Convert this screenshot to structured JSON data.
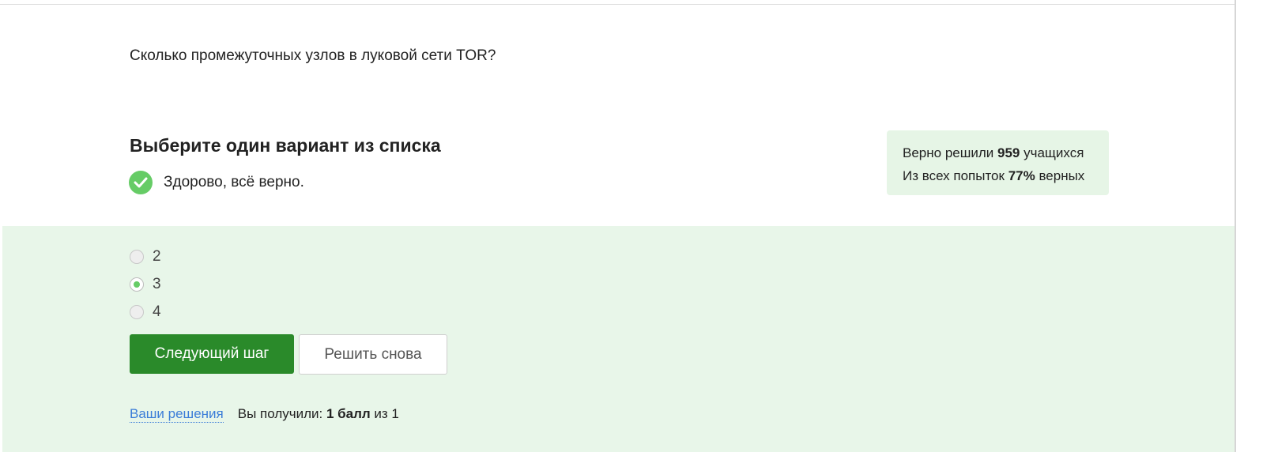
{
  "question": {
    "text": "Сколько промежуточных узлов в луковой сети TOR?"
  },
  "instruction": "Выберите один вариант из списка",
  "feedback": {
    "icon": "check-circle-icon",
    "text": "Здорово, всё верно."
  },
  "stats": {
    "solved_prefix": "Верно решили ",
    "solved_count": "959",
    "solved_suffix": " учащихся",
    "attempts_prefix": "Из всех попыток ",
    "attempts_percent": "77%",
    "attempts_suffix": " верных"
  },
  "options": [
    {
      "label": "2",
      "selected": false
    },
    {
      "label": "3",
      "selected": true
    },
    {
      "label": "4",
      "selected": false
    }
  ],
  "buttons": {
    "next_label": "Следующий шаг",
    "retry_label": "Решить снова"
  },
  "footer": {
    "solutions_link": "Ваши решения",
    "score_prefix": "Вы получили: ",
    "score_value": "1 балл",
    "score_suffix": " из 1"
  },
  "colors": {
    "success": "#66cc66",
    "primary_button": "#2a8a2a",
    "answer_background": "#e8f6e9",
    "stats_background": "#e6f5e6",
    "link": "#3b7dd8"
  }
}
